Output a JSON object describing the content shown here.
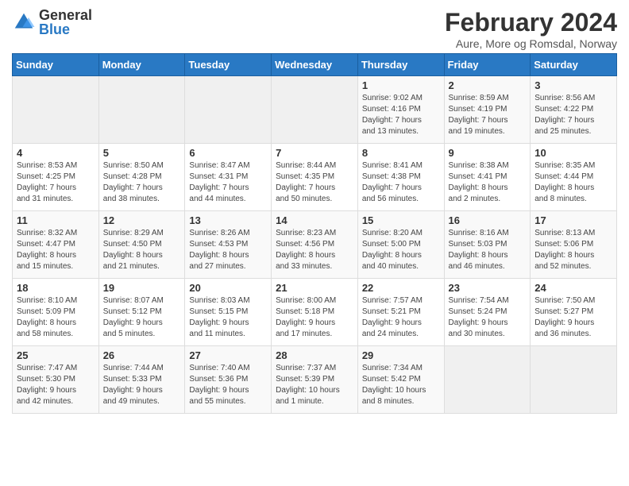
{
  "logo": {
    "general": "General",
    "blue": "Blue"
  },
  "title": "February 2024",
  "subtitle": "Aure, More og Romsdal, Norway",
  "headers": [
    "Sunday",
    "Monday",
    "Tuesday",
    "Wednesday",
    "Thursday",
    "Friday",
    "Saturday"
  ],
  "weeks": [
    [
      {
        "day": "",
        "info": ""
      },
      {
        "day": "",
        "info": ""
      },
      {
        "day": "",
        "info": ""
      },
      {
        "day": "",
        "info": ""
      },
      {
        "day": "1",
        "info": "Sunrise: 9:02 AM\nSunset: 4:16 PM\nDaylight: 7 hours\nand 13 minutes."
      },
      {
        "day": "2",
        "info": "Sunrise: 8:59 AM\nSunset: 4:19 PM\nDaylight: 7 hours\nand 19 minutes."
      },
      {
        "day": "3",
        "info": "Sunrise: 8:56 AM\nSunset: 4:22 PM\nDaylight: 7 hours\nand 25 minutes."
      }
    ],
    [
      {
        "day": "4",
        "info": "Sunrise: 8:53 AM\nSunset: 4:25 PM\nDaylight: 7 hours\nand 31 minutes."
      },
      {
        "day": "5",
        "info": "Sunrise: 8:50 AM\nSunset: 4:28 PM\nDaylight: 7 hours\nand 38 minutes."
      },
      {
        "day": "6",
        "info": "Sunrise: 8:47 AM\nSunset: 4:31 PM\nDaylight: 7 hours\nand 44 minutes."
      },
      {
        "day": "7",
        "info": "Sunrise: 8:44 AM\nSunset: 4:35 PM\nDaylight: 7 hours\nand 50 minutes."
      },
      {
        "day": "8",
        "info": "Sunrise: 8:41 AM\nSunset: 4:38 PM\nDaylight: 7 hours\nand 56 minutes."
      },
      {
        "day": "9",
        "info": "Sunrise: 8:38 AM\nSunset: 4:41 PM\nDaylight: 8 hours\nand 2 minutes."
      },
      {
        "day": "10",
        "info": "Sunrise: 8:35 AM\nSunset: 4:44 PM\nDaylight: 8 hours\nand 8 minutes."
      }
    ],
    [
      {
        "day": "11",
        "info": "Sunrise: 8:32 AM\nSunset: 4:47 PM\nDaylight: 8 hours\nand 15 minutes."
      },
      {
        "day": "12",
        "info": "Sunrise: 8:29 AM\nSunset: 4:50 PM\nDaylight: 8 hours\nand 21 minutes."
      },
      {
        "day": "13",
        "info": "Sunrise: 8:26 AM\nSunset: 4:53 PM\nDaylight: 8 hours\nand 27 minutes."
      },
      {
        "day": "14",
        "info": "Sunrise: 8:23 AM\nSunset: 4:56 PM\nDaylight: 8 hours\nand 33 minutes."
      },
      {
        "day": "15",
        "info": "Sunrise: 8:20 AM\nSunset: 5:00 PM\nDaylight: 8 hours\nand 40 minutes."
      },
      {
        "day": "16",
        "info": "Sunrise: 8:16 AM\nSunset: 5:03 PM\nDaylight: 8 hours\nand 46 minutes."
      },
      {
        "day": "17",
        "info": "Sunrise: 8:13 AM\nSunset: 5:06 PM\nDaylight: 8 hours\nand 52 minutes."
      }
    ],
    [
      {
        "day": "18",
        "info": "Sunrise: 8:10 AM\nSunset: 5:09 PM\nDaylight: 8 hours\nand 58 minutes."
      },
      {
        "day": "19",
        "info": "Sunrise: 8:07 AM\nSunset: 5:12 PM\nDaylight: 9 hours\nand 5 minutes."
      },
      {
        "day": "20",
        "info": "Sunrise: 8:03 AM\nSunset: 5:15 PM\nDaylight: 9 hours\nand 11 minutes."
      },
      {
        "day": "21",
        "info": "Sunrise: 8:00 AM\nSunset: 5:18 PM\nDaylight: 9 hours\nand 17 minutes."
      },
      {
        "day": "22",
        "info": "Sunrise: 7:57 AM\nSunset: 5:21 PM\nDaylight: 9 hours\nand 24 minutes."
      },
      {
        "day": "23",
        "info": "Sunrise: 7:54 AM\nSunset: 5:24 PM\nDaylight: 9 hours\nand 30 minutes."
      },
      {
        "day": "24",
        "info": "Sunrise: 7:50 AM\nSunset: 5:27 PM\nDaylight: 9 hours\nand 36 minutes."
      }
    ],
    [
      {
        "day": "25",
        "info": "Sunrise: 7:47 AM\nSunset: 5:30 PM\nDaylight: 9 hours\nand 42 minutes."
      },
      {
        "day": "26",
        "info": "Sunrise: 7:44 AM\nSunset: 5:33 PM\nDaylight: 9 hours\nand 49 minutes."
      },
      {
        "day": "27",
        "info": "Sunrise: 7:40 AM\nSunset: 5:36 PM\nDaylight: 9 hours\nand 55 minutes."
      },
      {
        "day": "28",
        "info": "Sunrise: 7:37 AM\nSunset: 5:39 PM\nDaylight: 10 hours\nand 1 minute."
      },
      {
        "day": "29",
        "info": "Sunrise: 7:34 AM\nSunset: 5:42 PM\nDaylight: 10 hours\nand 8 minutes."
      },
      {
        "day": "",
        "info": ""
      },
      {
        "day": "",
        "info": ""
      }
    ]
  ]
}
